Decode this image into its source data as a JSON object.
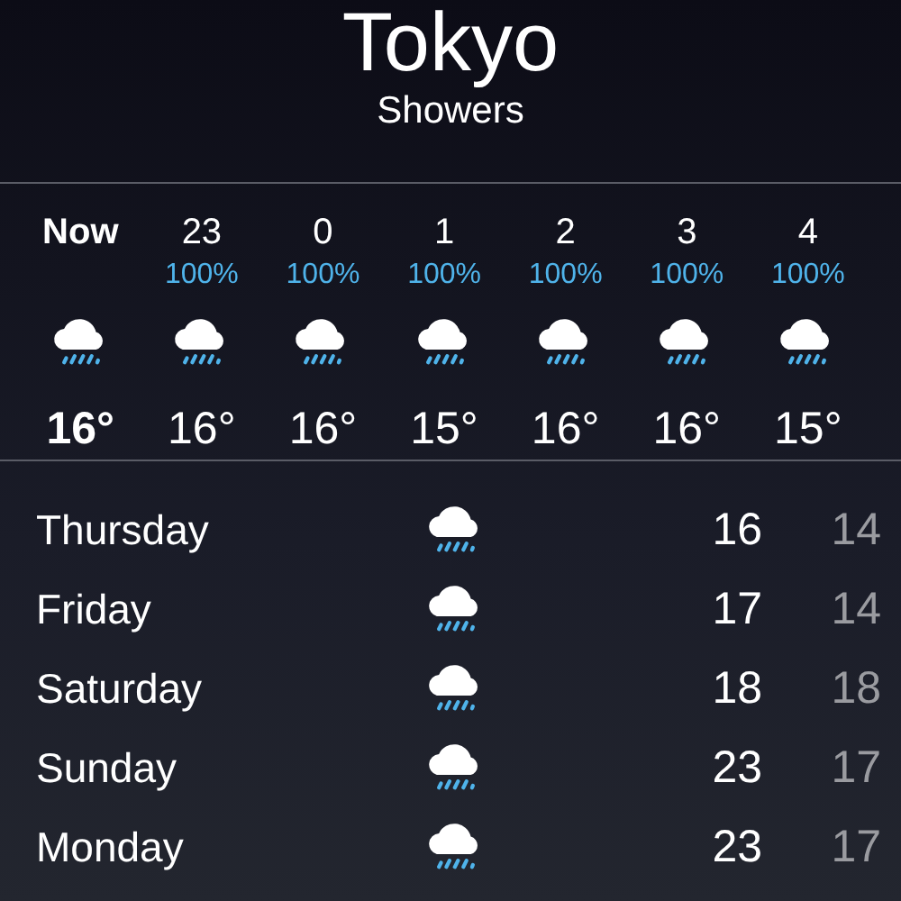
{
  "location": {
    "city": "Tokyo",
    "condition": "Showers"
  },
  "hourly": [
    {
      "time": "Now",
      "current": true,
      "temp": "16°"
    },
    {
      "time": "23",
      "current": false,
      "precipitation": "100%",
      "temp": "16°"
    },
    {
      "time": "0",
      "current": false,
      "precipitation": "100%",
      "temp": "16°"
    },
    {
      "time": "1",
      "current": false,
      "precipitation": "100%",
      "temp": "15°"
    },
    {
      "time": "2",
      "current": false,
      "precipitation": "100%",
      "temp": "16°"
    },
    {
      "time": "3",
      "current": false,
      "precipitation": "100%",
      "temp": "16°"
    },
    {
      "time": "4",
      "current": false,
      "precipitation": "100%",
      "temp": "15°"
    }
  ],
  "daily": [
    {
      "day": "Thursday",
      "high": "16",
      "low": "14"
    },
    {
      "day": "Friday",
      "high": "17",
      "low": "14"
    },
    {
      "day": "Saturday",
      "high": "18",
      "low": "18"
    },
    {
      "day": "Sunday",
      "high": "23",
      "low": "17"
    },
    {
      "day": "Monday",
      "high": "23",
      "low": "17"
    }
  ]
}
